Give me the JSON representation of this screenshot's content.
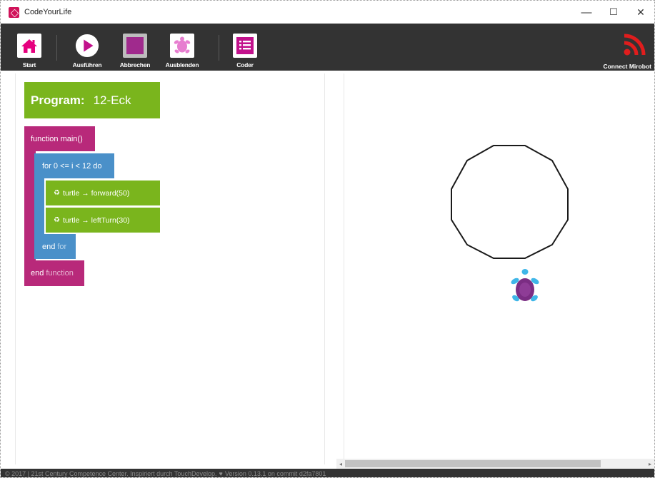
{
  "window": {
    "title": "CodeYourLife",
    "controls": {
      "minimize": "—",
      "maximize": "☐",
      "close": "✕"
    }
  },
  "toolbar": {
    "items": [
      {
        "label": "Start",
        "icon": "home-icon",
        "color": "#e6007e"
      },
      {
        "label": "Ausführen",
        "icon": "play-icon",
        "color": "#c2118c"
      },
      {
        "label": "Abbrechen",
        "icon": "stop-icon",
        "color": "#a02a8d"
      },
      {
        "label": "Ausblenden",
        "icon": "turtle-icon",
        "color": "#e77ed0"
      },
      {
        "label": "Coder",
        "icon": "list-icon",
        "color": "#c2118c"
      }
    ],
    "connect_label": "Connect Mirobot",
    "connect_icon": "wifi-signal-icon",
    "connect_color": "#e01d1d"
  },
  "program": {
    "label": "Program:",
    "name": "12-Eck"
  },
  "code": {
    "function_head": "function main()",
    "for_head": "for 0 <= i < 12 do",
    "statements": [
      "turtle → forward(50)",
      "turtle → leftTurn(30)"
    ],
    "for_end_kw": "end",
    "for_end_word": "for",
    "function_end_kw": "end",
    "function_end_word": "function"
  },
  "canvas": {
    "shape": "12-gon polygon",
    "turtle_icon": "turtle-sprite",
    "turtle_color": "#7b2d83",
    "turtle_limb_color": "#3fb6e8"
  },
  "footer": {
    "left": "© 2017 | 21st Century Competence Center. Inspiriert durch TouchDevelop.",
    "right": "Version 0.13.1 on commit d2fa7801"
  }
}
